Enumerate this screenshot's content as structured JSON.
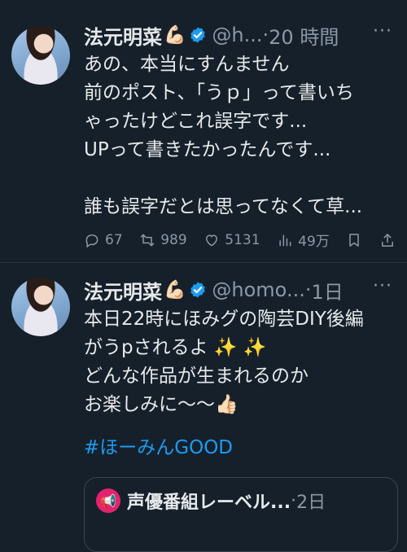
{
  "tweets": [
    {
      "name": "法元明菜",
      "emoji": "💪🏻",
      "handle": "@h...",
      "time": "20 時間",
      "lines": [
        "あの、本当にすんません",
        "前のポスト、「うｐ」って書いち",
        "ゃったけどこれ誤字です...",
        "UPって書きたかったんです...",
        "",
        "誰も誤字だとは思ってなくて草..."
      ],
      "actions": {
        "replies": "67",
        "reposts": "989",
        "likes": "5131",
        "views": "49万"
      }
    },
    {
      "name": "法元明菜",
      "emoji": "💪🏻",
      "handle": "@homo...",
      "time": "1日",
      "lines": [
        "本日22時にほみグの陶芸DIY後編",
        "がうpされるよ ✨ ✨",
        "どんな作品が生まれるのか",
        "お楽しみに〜〜👍🏻"
      ],
      "hashtag": "#ほーみんGOOD",
      "quote": {
        "name": "声優番組レーベル...",
        "time": "2日"
      }
    }
  ],
  "ui": {
    "dot": "·",
    "more": "···"
  },
  "colors": {
    "background": "#15202b",
    "text": "#e7e9ea",
    "muted": "#8b98a5",
    "link": "#1d9bf0",
    "verified": "#1d9bf0"
  }
}
